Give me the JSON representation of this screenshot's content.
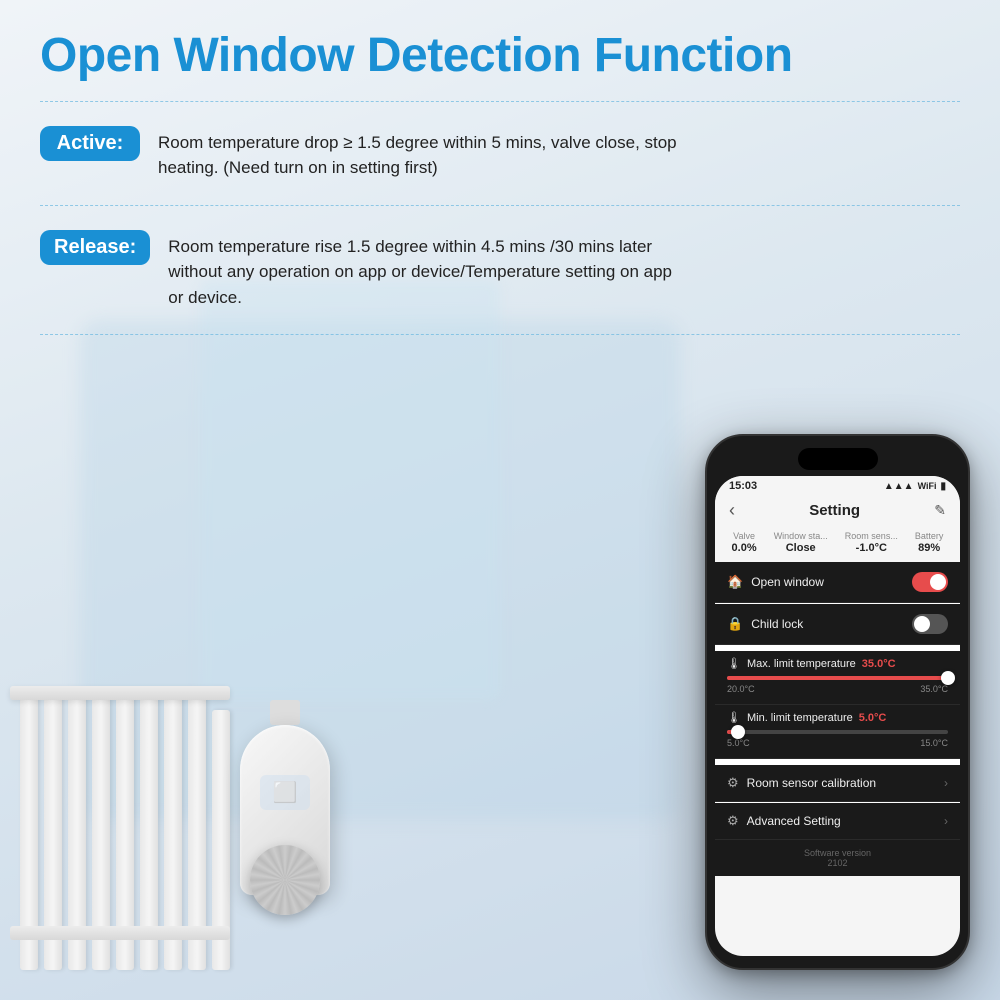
{
  "page": {
    "title": "Open Window Detection Function",
    "divider_style": "dashed"
  },
  "active_section": {
    "badge": "Active:",
    "description": "Room temperature drop ≥ 1.5 degree within 5 mins, valve close, stop heating. (Need turn on in setting first)"
  },
  "release_section": {
    "badge": "Release:",
    "description": "Room temperature rise 1.5 degree within 4.5 mins /30 mins later without any operation on app or device/Temperature setting on app or device."
  },
  "phone": {
    "time": "15:03",
    "screen_title": "Setting",
    "stats": [
      {
        "label": "Valve",
        "value": "0.0%"
      },
      {
        "label": "Window sta...",
        "value": "Close"
      },
      {
        "label": "Room sens...",
        "value": "-1.0°C"
      },
      {
        "label": "Battery",
        "value": "89%"
      }
    ],
    "settings": [
      {
        "id": "open-window",
        "icon": "🏠",
        "label": "Open window",
        "type": "toggle",
        "toggle_state": "on"
      },
      {
        "id": "child-lock",
        "icon": "🔒",
        "label": "Child lock",
        "type": "toggle",
        "toggle_state": "off"
      }
    ],
    "max_temp": {
      "icon": "🌡",
      "label": "Max. limit temperature",
      "value": "35.0°C",
      "min": "20.0°C",
      "max": "35.0°C",
      "fill_percent": 100
    },
    "min_temp": {
      "icon": "🌡",
      "label": "Min. limit temperature",
      "value": "5.0°C",
      "min": "5.0°C",
      "max": "15.0°C",
      "fill_percent": 5
    },
    "room_sensor": {
      "icon": "⚙",
      "label": "Room sensor calibration"
    },
    "advanced": {
      "icon": "⚙",
      "label": "Advanced Setting"
    },
    "software_version_label": "Software version",
    "software_version": "2102"
  },
  "icons": {
    "back": "‹",
    "edit": "✎",
    "chevron": "›",
    "signal": "▲▲▲",
    "wifi": "WiFi",
    "battery": "▮"
  }
}
